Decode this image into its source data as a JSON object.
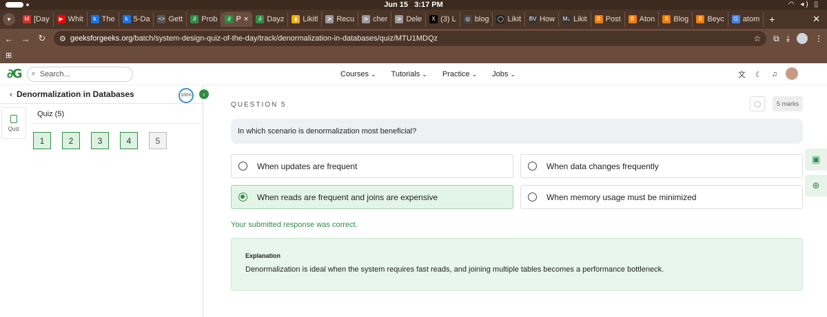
{
  "os": {
    "date": "Jun 15",
    "time": "3:17 PM"
  },
  "browser": {
    "tabs": [
      {
        "label": "[Day",
        "fav": "M",
        "color": "#d93025",
        "active": false
      },
      {
        "label": "Whit",
        "fav": "▶",
        "color": "#ff0000",
        "active": false
      },
      {
        "label": "The",
        "fav": "k",
        "color": "#1a73e8",
        "active": false
      },
      {
        "label": "5-Da",
        "fav": "k",
        "color": "#1a73e8",
        "active": false
      },
      {
        "label": "Gett",
        "fav": "<>",
        "color": "#555",
        "active": false
      },
      {
        "label": "Prob",
        "fav": "∂",
        "color": "#2f8d46",
        "active": false
      },
      {
        "label": "P",
        "fav": "∂",
        "color": "#2f8d46",
        "active": true
      },
      {
        "label": "Dayz",
        "fav": "∂",
        "color": "#2f8d46",
        "active": false
      },
      {
        "label": "Likitl",
        "fav": "▮",
        "color": "#f9ab00",
        "active": false
      },
      {
        "label": "Recu",
        "fav": "≽",
        "color": "#999",
        "active": false
      },
      {
        "label": "cher",
        "fav": "≽",
        "color": "#999",
        "active": false
      },
      {
        "label": "Dele",
        "fav": "≽",
        "color": "#999",
        "active": false
      },
      {
        "label": "(3) L",
        "fav": "X",
        "color": "#000",
        "active": false
      },
      {
        "label": "blog",
        "fav": "◎",
        "color": "#444",
        "active": false
      },
      {
        "label": "Likit",
        "fav": "◯",
        "color": "#222",
        "active": false
      },
      {
        "label": "How",
        "fav": "BV",
        "color": "#333",
        "active": false
      },
      {
        "label": "Likit",
        "fav": "M↓",
        "color": "#333",
        "active": false
      },
      {
        "label": "Post",
        "fav": "B",
        "color": "#f57c00",
        "active": false
      },
      {
        "label": "Aton",
        "fav": "B",
        "color": "#f57c00",
        "active": false
      },
      {
        "label": "Blog",
        "fav": "B",
        "color": "#f57c00",
        "active": false
      },
      {
        "label": "Beyc",
        "fav": "B",
        "color": "#f57c00",
        "active": false
      },
      {
        "label": "atom",
        "fav": "G",
        "color": "#4285f4",
        "active": false
      }
    ],
    "new_tab": "+",
    "close": "✕",
    "url_host": "geeksforgeeks.org",
    "url_path": "/batch/system-design-quiz-of-the-day/track/denormalization-in-databases/quiz/MTU1MDQz"
  },
  "site": {
    "logo": "∂G",
    "search_placeholder": "Search...",
    "nav": [
      "Courses",
      "Tutorials",
      "Practice",
      "Jobs"
    ]
  },
  "sidebar": {
    "course_title": "Denormalization in Databases",
    "progress": "100%",
    "tab_label": "Quiz",
    "quiz_title": "Quiz (5)",
    "questions": [
      "1",
      "2",
      "3",
      "4",
      "5"
    ],
    "current_question": 5
  },
  "question": {
    "label": "QUESTION 5",
    "marks": "5 marks",
    "text": "In which scenario is denormalization most beneficial?",
    "options": [
      {
        "text": "When updates are frequent",
        "selected": false
      },
      {
        "text": "When data changes frequently",
        "selected": false
      },
      {
        "text": "When reads are frequent and joins are expensive",
        "selected": true
      },
      {
        "text": "When memory usage must be minimized",
        "selected": false
      }
    ],
    "feedback": "Your submitted response was correct.",
    "explanation_heading": "Explanation",
    "explanation_text": "Denormalization is ideal when the system requires fast reads, and joining multiple tables becomes a performance bottleneck."
  }
}
